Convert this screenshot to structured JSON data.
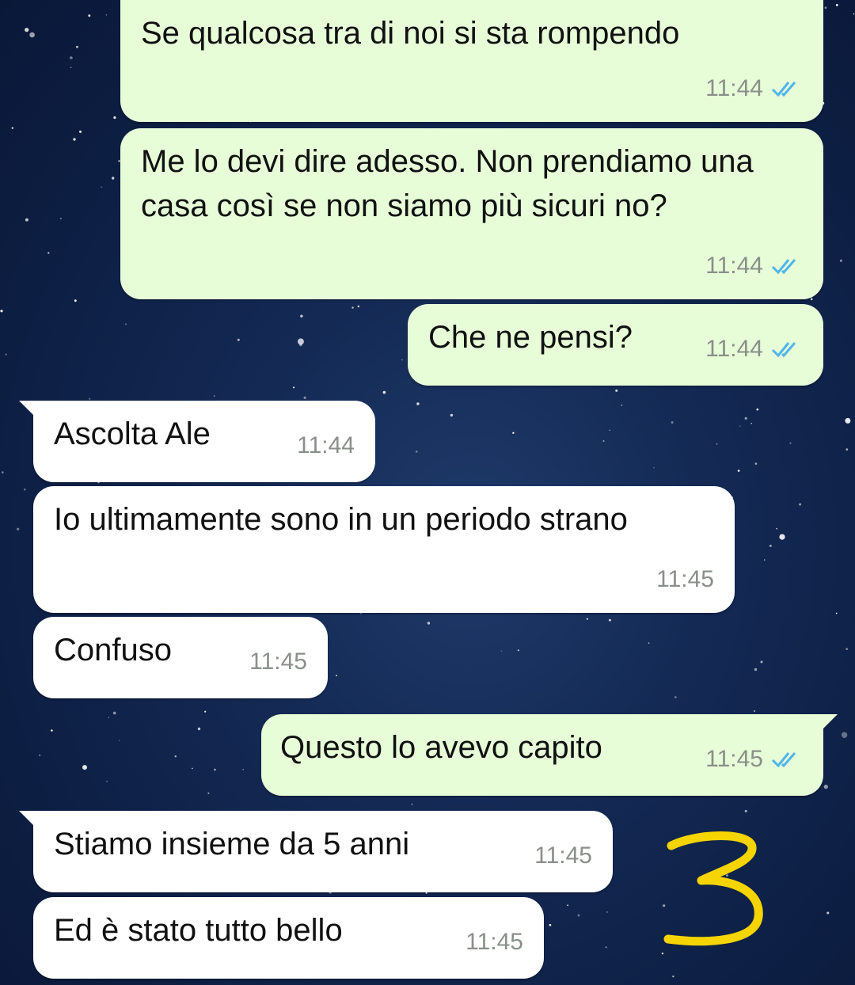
{
  "messages": [
    {
      "direction": "out",
      "text": "Se qualcosa tra di noi si sta rompendo",
      "time": "11:44",
      "status": "read"
    },
    {
      "direction": "out",
      "text": "Me lo devi dire adesso. Non prendiamo una casa così se non siamo più sicuri no?",
      "time": "11:44",
      "status": "read"
    },
    {
      "direction": "out",
      "text": "Che ne pensi?",
      "time": "11:44",
      "status": "read"
    },
    {
      "direction": "in",
      "text": "Ascolta Ale",
      "time": "11:44"
    },
    {
      "direction": "in",
      "text": "Io ultimamente sono in un periodo strano",
      "time": "11:45"
    },
    {
      "direction": "in",
      "text": "Confuso",
      "time": "11:45"
    },
    {
      "direction": "out",
      "text": "Questo lo avevo capito",
      "time": "11:45",
      "status": "read"
    },
    {
      "direction": "in",
      "text": "Stiamo insieme da 5 anni",
      "time": "11:45"
    },
    {
      "direction": "in",
      "text": "Ed è stato tutto bello",
      "time": "11:45"
    }
  ],
  "annotation": {
    "text": "3",
    "color": "#f5d400"
  },
  "colors": {
    "outgoing_bubble": "#e7fdd8",
    "incoming_bubble": "#ffffff",
    "read_ticks": "#4fb6ec",
    "wallpaper": "#142a55"
  }
}
